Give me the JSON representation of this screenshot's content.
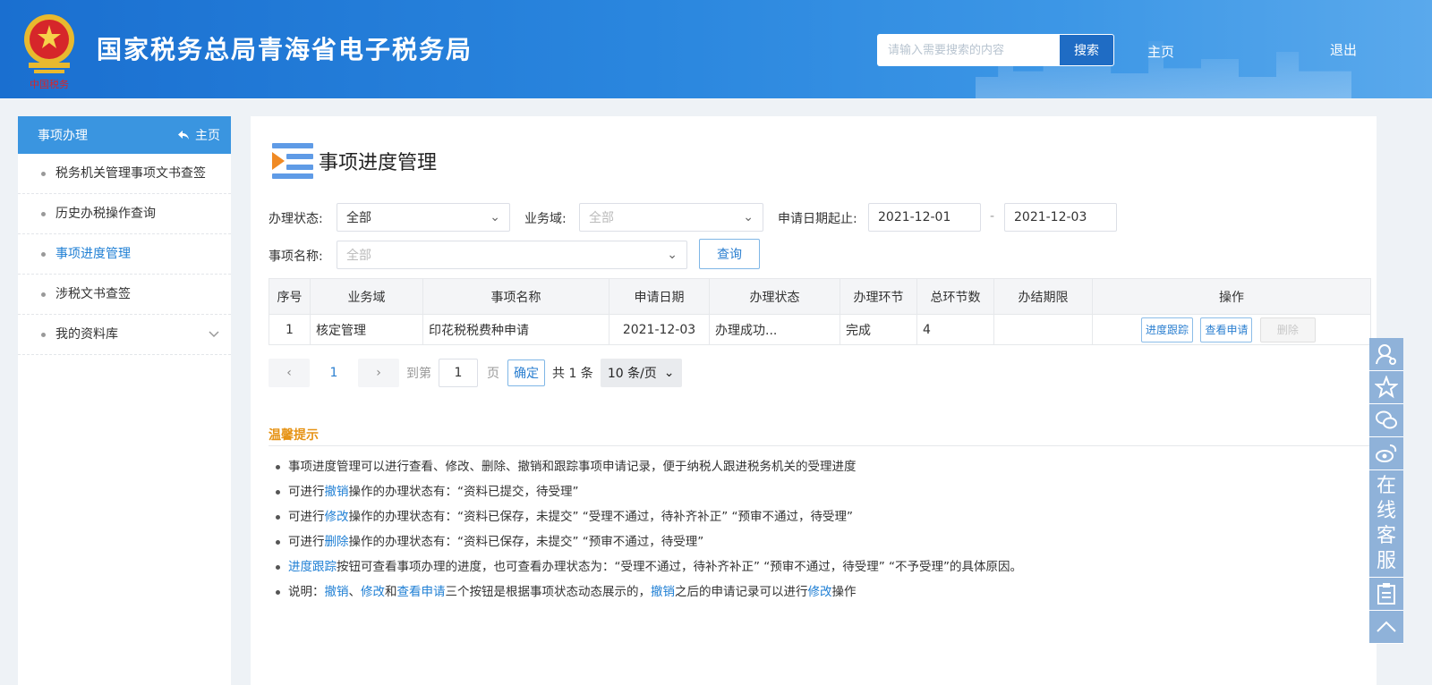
{
  "header": {
    "site_title": "国家税务总局青海省电子税务局",
    "search_placeholder": "请输入需要搜索的内容",
    "search_button": "搜索",
    "nav_home": "主页",
    "nav_logout": "退出",
    "emblem_text": "中国税务",
    "colors": {
      "header_start": "#1a6fd0",
      "header_end": "#5aa9ec"
    }
  },
  "sidebar": {
    "heading": "事项办理",
    "home_link": "主页",
    "items": [
      {
        "label": "税务机关管理事项文书查签"
      },
      {
        "label": "历史办税操作查询"
      },
      {
        "label": "事项进度管理",
        "active": true
      },
      {
        "label": "涉税文书查签"
      },
      {
        "label": "我的资料库",
        "expandable": true
      }
    ]
  },
  "main": {
    "title": "事项进度管理",
    "filters": {
      "status_label": "办理状态:",
      "status_value": "全部",
      "domain_label": "业务域:",
      "domain_placeholder": "全部",
      "date_label": "申请日期起止:",
      "date_from": "2021-12-01",
      "date_separator": "-",
      "date_to": "2021-12-03",
      "name_label": "事项名称:",
      "name_placeholder": "全部",
      "query_button": "查询"
    },
    "table": {
      "columns": [
        "序号",
        "业务域",
        "事项名称",
        "申请日期",
        "办理状态",
        "办理环节",
        "总环节数",
        "办结期限",
        "操作"
      ],
      "rows": [
        {
          "index": "1",
          "domain": "核定管理",
          "name": "印花税税费种申请",
          "date": "2021-12-03",
          "status": "办理成功...",
          "stage": "完成",
          "total_stages": "4",
          "deadline": "",
          "actions": {
            "track": "进度跟踪",
            "view": "查看申请",
            "delete": "删除"
          }
        }
      ]
    },
    "pager": {
      "prev": "‹",
      "current": "1",
      "next": "›",
      "goto_label": "到第",
      "goto_value": "1",
      "page_label": "页",
      "confirm": "确定",
      "total": "共 1 条",
      "page_size": "10 条/页"
    },
    "tips": {
      "title": "温馨提示",
      "items": [
        {
          "parts": [
            {
              "t": "事项进度管理可以进行查看、修改、删除、撤销和跟踪事项申请记录，便于纳税人跟进税务机关的受理进度"
            }
          ]
        },
        {
          "parts": [
            {
              "t": "可进行"
            },
            {
              "t": "撤销",
              "hl": true
            },
            {
              "t": "操作的办理状态有：“资料已提交，待受理”"
            }
          ]
        },
        {
          "parts": [
            {
              "t": "可进行"
            },
            {
              "t": "修改",
              "hl": true
            },
            {
              "t": "操作的办理状态有：“资料已保存，未提交”  “受理不通过，待补齐补正”  “预审不通过，待受理”"
            }
          ]
        },
        {
          "parts": [
            {
              "t": "可进行"
            },
            {
              "t": "删除",
              "hl": true
            },
            {
              "t": "操作的办理状态有：“资料已保存，未提交”  “预审不通过，待受理”"
            }
          ]
        },
        {
          "parts": [
            {
              "t": "进度跟踪",
              "hl": true
            },
            {
              "t": "按钮可查看事项办理的进度，也可查看办理状态为：“受理不通过，待补齐补正”  “预审不通过，待受理”  “不予受理”的具体原因。"
            }
          ]
        },
        {
          "parts": [
            {
              "t": "说明："
            },
            {
              "t": "撤销",
              "hl": true
            },
            {
              "t": "、"
            },
            {
              "t": "修改",
              "hl": true
            },
            {
              "t": "和"
            },
            {
              "t": "查看申请",
              "hl": true
            },
            {
              "t": "三个按钮是根据事项状态动态展示的，"
            },
            {
              "t": "撤销",
              "hl": true
            },
            {
              "t": "之后的申请记录可以进行"
            },
            {
              "t": "修改",
              "hl": true
            },
            {
              "t": "操作"
            }
          ]
        }
      ]
    }
  },
  "float_bar": {
    "items": [
      "user-icon",
      "star-icon",
      "wechat-icon",
      "weibo-icon"
    ],
    "customer_service": [
      "在",
      "线",
      "客",
      "服"
    ],
    "extra": [
      "clipboard-icon",
      "back-to-top-icon"
    ]
  }
}
